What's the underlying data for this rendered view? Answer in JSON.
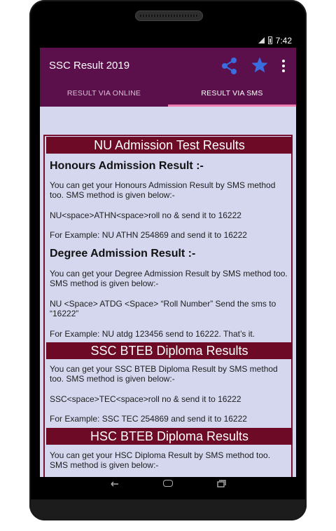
{
  "statusbar": {
    "time": "7:42"
  },
  "toolbar": {
    "title": "SSC Result 2019",
    "icons": [
      "share-icon",
      "star-icon",
      "more-vert-icon"
    ]
  },
  "tabs": [
    {
      "label": "RESULT VIA ONLINE",
      "active": false
    },
    {
      "label": "RESULT VIA SMS",
      "active": true
    }
  ],
  "colors": {
    "primary": "#5b0f4b",
    "section_header": "#6d0a26",
    "tab_indicator": "#f07ab0",
    "content_bg": "#d5d7ef",
    "star": "#3a6de0"
  },
  "sections": {
    "nu": {
      "header": "NU Admission Test Results",
      "honours_title": "Honours Admission Result :-",
      "honours_intro": "You can get your Honours Admission Result by SMS method too. SMS method is given below:-",
      "honours_format": "NU<space>ATHN<space>roll no & send it to 16222",
      "honours_example": "For Example: NU ATHN 254869 and send it to 16222",
      "degree_title": "Degree Admission Result :-",
      "degree_intro": "You can get your Degree Admission Result by SMS method too. SMS method is given below:-",
      "degree_format": "NU <Space> ATDG <Space> “Roll Number” Send the sms to “16222”",
      "degree_example": "For Example: NU atdg 123456 send to 16222. That’s it."
    },
    "ssc": {
      "header": "SSC BTEB Diploma Results",
      "intro": "You can get your SSC BTEB Diploma Result by SMS method too. SMS method is given below:-",
      "format": "SSC<space>TEC<space>roll no & send it to 16222",
      "example": "For Example: SSC TEC 254869 and send it to 16222"
    },
    "hsc": {
      "header": "HSC BTEB Diploma Results",
      "intro": " You can get your HSC Diploma Result by SMS method too. SMS method is given below:-"
    }
  }
}
